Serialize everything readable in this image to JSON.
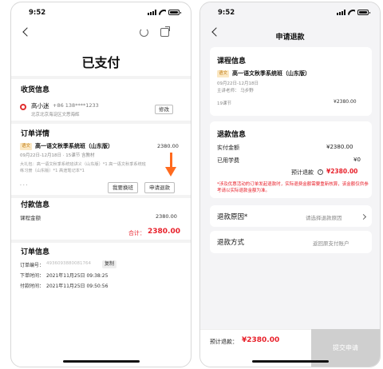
{
  "left": {
    "status": {
      "time": "9:52"
    },
    "title": "已支付",
    "shipping": {
      "section_title": "收货信息",
      "name": "高小迷",
      "phone": "+86 138****1233",
      "address": "北京北京海淀区文思海辉",
      "edit_button": "修改"
    },
    "order_detail": {
      "section_title": "订单详情",
      "subject_tag": "语文",
      "course_name": "高一语文秋季系统班（山东版）",
      "price": "2380.00",
      "meta": "09月22日-12月18日 · 15课节  含教材",
      "materials_line1": "大礼包：高一语文秋季系统班讲义（山东版）*1  高一语文秋季系统班",
      "materials_line2": "练习册（山东版）*1  高途笔记本*1",
      "dots": "· · ·",
      "change_class_button": "我要换班",
      "refund_button": "申请退款"
    },
    "payment": {
      "section_title": "付款信息",
      "label": "课程金额",
      "amount": "2380.00",
      "total_label": "合计：",
      "total_value": "2380.00"
    },
    "order_info": {
      "section_title": "订单信息",
      "order_no_label": "订单编号：",
      "order_no": "4936093880081764",
      "copy_button": "复制",
      "order_time_label": "下单时间：",
      "order_time": "2021年11月25日 09:38:25",
      "pay_time_label": "付款时间：",
      "pay_time": "2021年11月25日 09:50:56"
    }
  },
  "right": {
    "status": {
      "time": "9:52"
    },
    "title": "申请退款",
    "course_card": {
      "section_title": "课程信息",
      "subject_tag": "语文",
      "course_name": "高一语文秋季系统班（山东版）",
      "date": "09月22日-12月18日",
      "teacher": "主讲老师： 马步野",
      "lessons": "19课节",
      "price": "¥2380.00"
    },
    "refund_info": {
      "section_title": "退款信息",
      "paid_label": "实付金额",
      "paid_value": "¥2380.00",
      "used_label": "已用学费",
      "used_value": "¥0",
      "estimate_label": "预计退款",
      "estimate_value": "¥2380.00"
    },
    "notice": "*涉及优惠活动的订单发起退款时，实际退费金额需要重新核算，该金额仅供参考请以实际退款金额为准。",
    "reason": {
      "label": "退款原因*",
      "placeholder": "请选择退款原因"
    },
    "method": {
      "label": "退款方式",
      "value": "返回原支付账户"
    },
    "footer": {
      "estimate_label": "预计退款：",
      "estimate_value": "¥2380.00",
      "submit_button": "提交申请"
    }
  },
  "colors": {
    "accent_red": "#e8212b",
    "arrow_orange": "#ff6a1e",
    "tag_bg": "#fbe8c4",
    "disabled_gray": "#cfcfcf"
  }
}
